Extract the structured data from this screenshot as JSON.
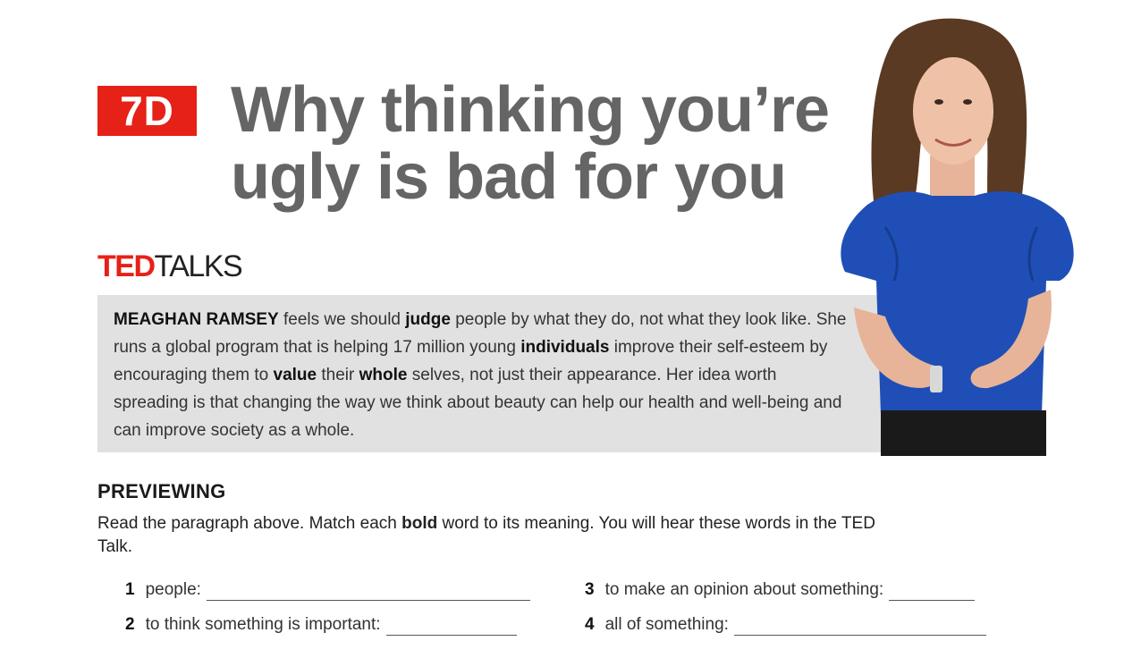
{
  "unit": {
    "badge": "7D",
    "badge_color": "#e62117"
  },
  "title": {
    "line1": "Why thinking you’re",
    "line2": "ugly is bad for you"
  },
  "logo": {
    "ted": "TED",
    "talks": "TALKS"
  },
  "intro": {
    "segments": [
      {
        "text": "MEAGHAN RAMSEY",
        "bold": true
      },
      {
        "text": " feels we should ",
        "bold": false
      },
      {
        "text": "judge",
        "bold": true
      },
      {
        "text": " people by what they do, not what they look like. She runs a global program that is helping 17 million young ",
        "bold": false
      },
      {
        "text": "individuals",
        "bold": true
      },
      {
        "text": " improve their self-esteem by encouraging them to ",
        "bold": false
      },
      {
        "text": "value",
        "bold": true
      },
      {
        "text": " their ",
        "bold": false
      },
      {
        "text": "whole",
        "bold": true
      },
      {
        "text": " selves, not just their appearance. Her idea worth spreading is that changing the way we think about beauty can help our health and well-being and can improve society as a whole.",
        "bold": false
      }
    ]
  },
  "previewing": {
    "heading": "PREVIEWING",
    "instructions": [
      {
        "text": "Read the paragraph above. Match each ",
        "bold": false
      },
      {
        "text": "bold",
        "bold": true
      },
      {
        "text": " word to its meaning. You will hear these words in the TED Talk.",
        "bold": false
      }
    ],
    "items": [
      {
        "number": "1",
        "text": "people:"
      },
      {
        "number": "2",
        "text": "to think something is important:"
      },
      {
        "number": "3",
        "text": "to make an opinion about something:"
      },
      {
        "number": "4",
        "text": "all of something:"
      }
    ]
  }
}
